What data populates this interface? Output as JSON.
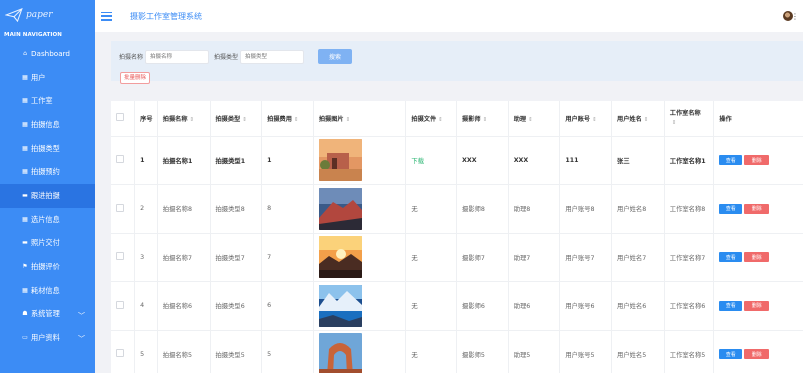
{
  "sidebar": {
    "logo_text": "paper",
    "nav_header": "MAIN NAVIGATION",
    "items": [
      {
        "label": "Dashboard",
        "icon": "home-icon"
      },
      {
        "label": "用户",
        "icon": "grid-icon"
      },
      {
        "label": "工作室",
        "icon": "grid-icon"
      },
      {
        "label": "拍摄信息",
        "icon": "grid-icon"
      },
      {
        "label": "拍摄类型",
        "icon": "grid-icon"
      },
      {
        "label": "拍摄预约",
        "icon": "grid-icon"
      },
      {
        "label": "跟进拍摄",
        "icon": "folder-icon",
        "active": true
      },
      {
        "label": "选片信息",
        "icon": "grid-icon"
      },
      {
        "label": "照片交付",
        "icon": "folder-icon"
      },
      {
        "label": "拍摄评价",
        "icon": "flag-icon"
      },
      {
        "label": "耗材信息",
        "icon": "grid-icon"
      },
      {
        "label": "系统管理",
        "icon": "people-icon",
        "chevron": "chevron-down-icon"
      },
      {
        "label": "用户资料",
        "icon": "card-icon",
        "chevron": "chevron-down-icon"
      }
    ]
  },
  "header": {
    "title": "摄影工作室管理系统",
    "menu_icon": "hamburger-icon",
    "more_icon": "⋮"
  },
  "search": {
    "name_label": "拍摄名称",
    "name_placeholder": "拍摄名称",
    "type_label": "拍摄类型",
    "type_placeholder": "拍摄类型",
    "search_button": "搜索",
    "batch_delete_button": "批量删除"
  },
  "table": {
    "columns": [
      "序号",
      "拍摄名称",
      "拍摄类型",
      "拍摄费用",
      "拍摄图片",
      "拍摄文件",
      "摄影师",
      "助理",
      "用户账号",
      "用户姓名",
      "工作室名称",
      "操作"
    ],
    "sortable": [
      "拍摄名称",
      "拍摄类型",
      "拍摄费用",
      "拍摄图片",
      "拍摄文件",
      "摄影师",
      "助理",
      "用户账号",
      "用户姓名",
      "工作室名称"
    ],
    "view_label": "查看",
    "delete_label": "删除",
    "rows": [
      {
        "index": "1",
        "name": "拍摄名称1",
        "type": "拍摄类型1",
        "fee": "1",
        "image": "desert-house",
        "file": "下载",
        "photographer": "XXX",
        "assistant": "XXX",
        "account": "111",
        "user_name": "张三",
        "studio": "工作室名称1"
      },
      {
        "index": "2",
        "name": "拍摄名称8",
        "type": "拍摄类型8",
        "fee": "8",
        "image": "red-mountain",
        "file": "无",
        "photographer": "摄影师8",
        "assistant": "助理8",
        "account": "用户账号8",
        "user_name": "用户姓名8",
        "studio": "工作室名称8"
      },
      {
        "index": "3",
        "name": "拍摄名称7",
        "type": "拍摄类型7",
        "fee": "7",
        "image": "sunset-mountain",
        "file": "无",
        "photographer": "摄影师7",
        "assistant": "助理7",
        "account": "用户账号7",
        "user_name": "用户姓名7",
        "studio": "工作室名称7"
      },
      {
        "index": "4",
        "name": "拍摄名称6",
        "type": "拍摄类型6",
        "fee": "6",
        "image": "blue-lake",
        "file": "无",
        "photographer": "摄影师6",
        "assistant": "助理6",
        "account": "用户账号6",
        "user_name": "用户姓名6",
        "studio": "工作室名称6"
      },
      {
        "index": "5",
        "name": "拍摄名称5",
        "type": "拍摄类型5",
        "fee": "5",
        "image": "rock-arch",
        "file": "无",
        "photographer": "摄影师5",
        "assistant": "助理5",
        "account": "用户账号5",
        "user_name": "用户姓名5",
        "studio": "工作室名称5"
      }
    ]
  },
  "colors": {
    "sidebar": "#3c8cf5",
    "sidebar_active": "#2a74e2",
    "view_button": "#2a8cf0",
    "delete_button": "#f06a6a",
    "download_link": "#2bb673"
  }
}
